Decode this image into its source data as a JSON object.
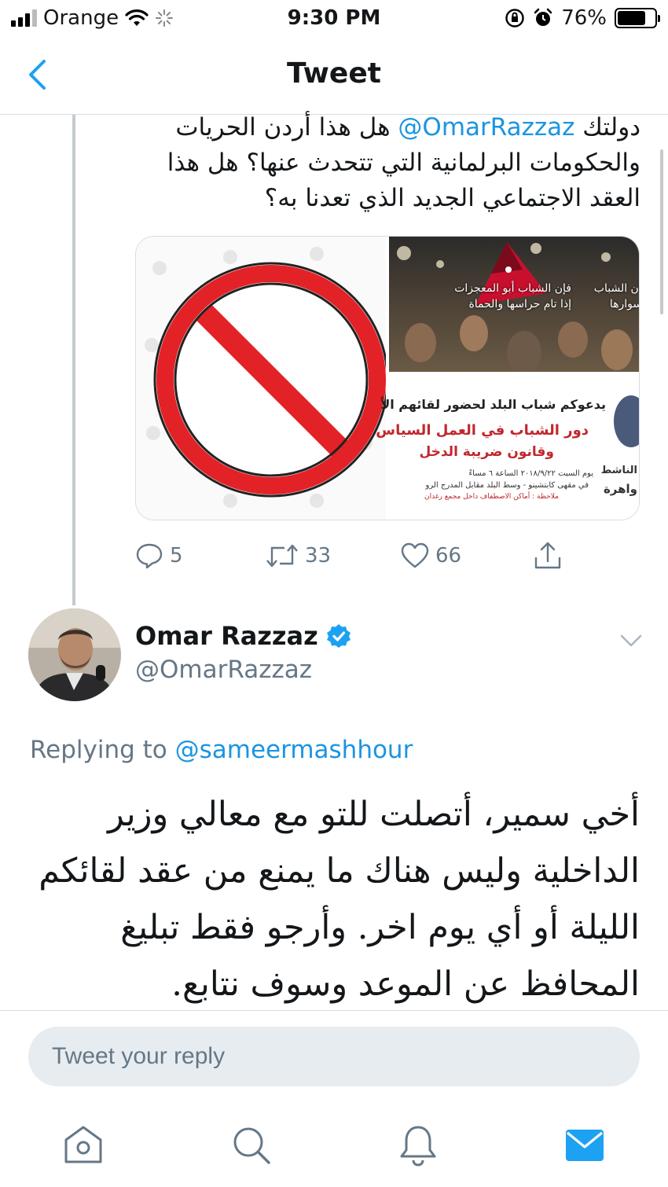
{
  "status_bar": {
    "carrier": "Orange",
    "time": "9:30 PM",
    "battery": "76%",
    "battery_level": 0.76
  },
  "nav": {
    "title": "Tweet"
  },
  "parent_tweet": {
    "mention": "@OmarRazzaz",
    "text_line1_start": "دولتك ",
    "text_line1_end": " هل هذا أردن الحريات",
    "text_rest": "والحكومات البرلمانية التي تتحدث عنها؟ هل هذا العقد الاجتماعي الجديد الذي تعدنا به؟",
    "media": {
      "crowd_caption_1": "فإن الشباب أبو المعجزات",
      "crowd_caption_2": "إذا تام حراسها والحماة",
      "crowd_caption_3": "بأن الشباب",
      "crowd_caption_4": "أسوارها",
      "poster_invite_prefix": "يدعوكم ",
      "poster_invite_org": "شباب البلد",
      "poster_invite_suffix": " لحضور لقائهم الأ",
      "poster_title_1": "دور الشباب في العمل السياس",
      "poster_title_2": "وقانون ضريبة الدخل",
      "poster_detail_1": "يوم السبت ٢٠١٨/٩/٢٢ الساعة ٦ مساءً",
      "poster_detail_2": "في مقهى كابتشينو - وسط البلد مقابل المدرج الرو",
      "poster_note": "ملاحظة : أماكن الاصطفاف داخل مجمع رغدان",
      "poster_side_1": "الناشط",
      "poster_side_2": "واهرة"
    },
    "actions": {
      "replies": "5",
      "retweets": "33",
      "likes": "66"
    }
  },
  "tweet": {
    "author_name": "Omar Razzaz",
    "author_handle": "@OmarRazzaz",
    "replying_label": "Replying to",
    "replying_to": "@sameermashhour",
    "text": "أخي سمير، أتصلت للتو مع معالي وزير الداخلية وليس هناك ما يمنع من عقد لقائكم الليلة أو أي يوم اخر. وأرجو فقط تبليغ المحافظ عن الموعد وسوف نتابع."
  },
  "reply": {
    "placeholder": "Tweet your reply"
  },
  "tabs": [
    {
      "icon": "home-icon"
    },
    {
      "icon": "search-icon"
    },
    {
      "icon": "notifications-icon"
    },
    {
      "icon": "messages-icon"
    }
  ],
  "colors": {
    "accent": "#1da1f2",
    "link": "#1b95e0",
    "secondary_text": "#657786",
    "no_sign_red": "#e32227"
  }
}
